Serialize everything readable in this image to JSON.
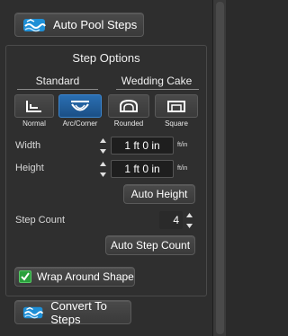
{
  "top_button": {
    "label": "Auto Pool Steps",
    "icon": "pool-icon"
  },
  "step_options": {
    "title": "Step Options",
    "standard": {
      "label": "Standard",
      "options": [
        {
          "caption": "Normal",
          "icon": "normal-step-icon"
        },
        {
          "caption": "Arc/Corner",
          "icon": "arc-corner-step-icon",
          "selected": true
        }
      ]
    },
    "wedding_cake": {
      "label": "Wedding Cake",
      "options": [
        {
          "caption": "Rounded",
          "icon": "rounded-step-icon"
        },
        {
          "caption": "Square",
          "icon": "square-step-icon"
        }
      ]
    },
    "width": {
      "label": "Width",
      "value": "1 ft 0 in",
      "unit": "ft/in"
    },
    "height": {
      "label": "Height",
      "value": "1 ft 0 in",
      "unit": "ft/in"
    },
    "auto_height_label": "Auto Height",
    "step_count": {
      "label": "Step Count",
      "value": "4"
    },
    "auto_step_count_label": "Auto Step Count",
    "wrap": {
      "label": "Wrap Around Shape",
      "checked": true
    }
  },
  "bottom_button": {
    "label": "Convert To Steps",
    "icon": "pool-icon"
  },
  "colors": {
    "accent": "#1f5f9c",
    "check": "#2aa03c"
  }
}
